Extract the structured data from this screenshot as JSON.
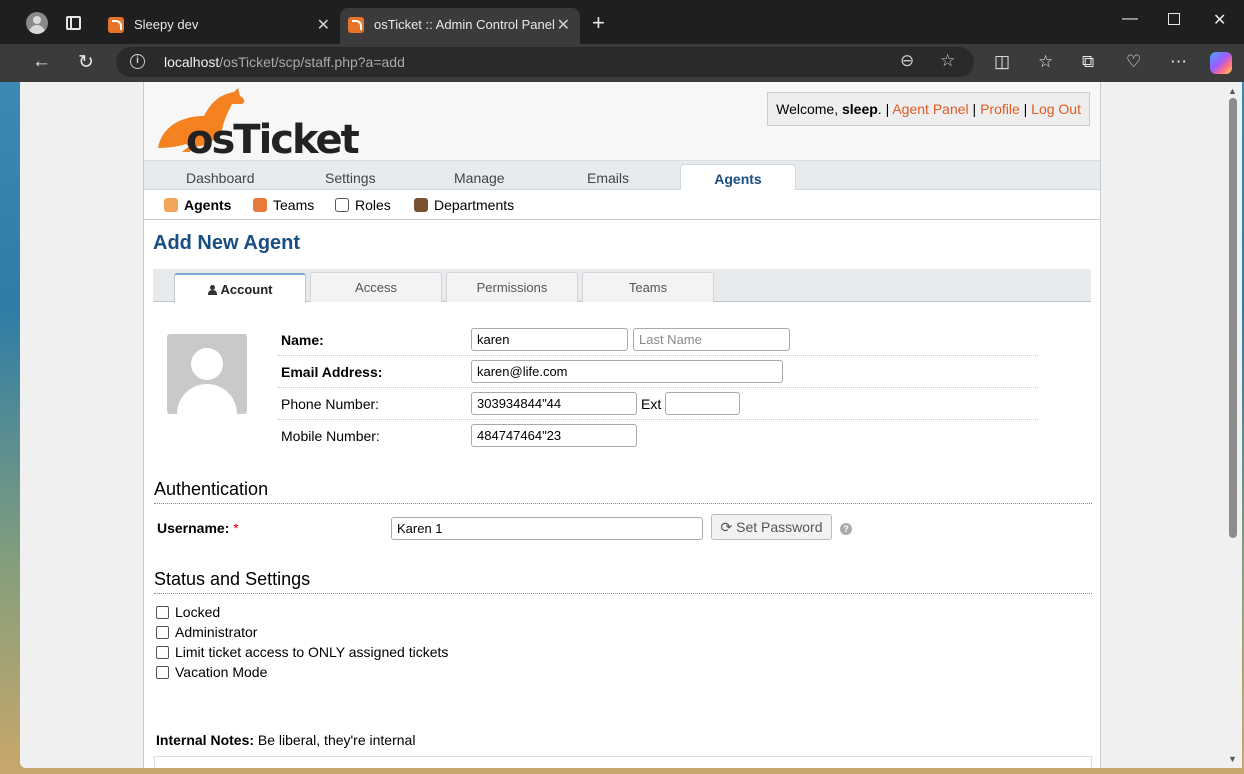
{
  "browser": {
    "tabs": [
      {
        "title": "Sleepy dev"
      },
      {
        "title": "osTicket :: Admin Control Panel"
      }
    ],
    "url": {
      "host": "localhost",
      "path": "/osTicket/scp/staff.php?a=add"
    }
  },
  "header": {
    "logo_text": "osTicket",
    "welcome_prefix": "Welcome, ",
    "user": "sleep",
    "links": [
      "Agent Panel",
      "Profile",
      "Log Out"
    ]
  },
  "main_nav": [
    "Dashboard",
    "Settings",
    "Manage",
    "Emails",
    "Agents"
  ],
  "main_nav_active": "Agents",
  "sub_nav": [
    "Agents",
    "Teams",
    "Roles",
    "Departments"
  ],
  "page_title": "Add New Agent",
  "form_tabs": [
    "Account",
    "Access",
    "Permissions",
    "Teams"
  ],
  "form_tab_active": "Account",
  "fields": {
    "name_label": "Name:",
    "first_name": "karen",
    "last_name_placeholder": "Last Name",
    "email_label": "Email Address:",
    "email": "karen@life.com",
    "phone_label": "Phone Number:",
    "phone": "303934844\"44",
    "ext_label": "Ext",
    "ext": "",
    "mobile_label": "Mobile Number:",
    "mobile": "484747464\"23"
  },
  "auth": {
    "heading": "Authentication",
    "username_label": "Username:",
    "required_mark": "*",
    "username": "Karen 1",
    "set_password": "Set Password",
    "help": "?"
  },
  "status": {
    "heading": "Status and Settings",
    "options": [
      {
        "label": "Locked",
        "checked": false
      },
      {
        "label": "Administrator",
        "checked": false
      },
      {
        "label": "Limit ticket access to ONLY assigned tickets",
        "checked": false
      },
      {
        "label": "Vacation Mode",
        "checked": false
      }
    ]
  },
  "notes": {
    "label": "Internal Notes:",
    "hint": "Be liberal, they're internal"
  },
  "colors": {
    "accent": "#184e81",
    "link": "#e05b22",
    "logo": "#f58220"
  }
}
